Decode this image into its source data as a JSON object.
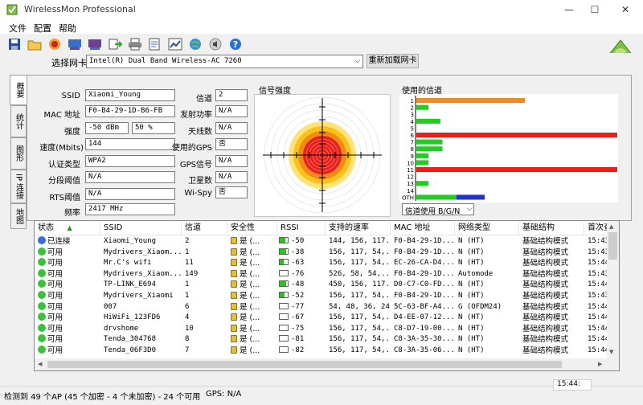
{
  "window": {
    "title": "WirelessMon Professional"
  },
  "menu": [
    {
      "label": "文件"
    },
    {
      "label": "配置"
    },
    {
      "label": "帮助"
    }
  ],
  "toolbar_icons": [
    "save-icon",
    "open-folder-icon",
    "record-icon",
    "network-card-icon",
    "network-card-alt-icon",
    "export-icon",
    "print-icon",
    "report-icon",
    "wifi-graph-icon",
    "globe-icon",
    "speaker-icon",
    "help-icon"
  ],
  "adapter": {
    "label": "选择网卡",
    "value": "Intel(R) Dual Band Wireless-AC 7260",
    "reload_label": "重新加载网卡"
  },
  "tabs": [
    {
      "label": "概要"
    },
    {
      "label": "统计"
    },
    {
      "label": "图形"
    },
    {
      "label": "IP 连接"
    },
    {
      "label": "地图"
    }
  ],
  "summary": {
    "ssid_label": "SSID",
    "ssid": "Xiaomi_Young",
    "mac_label": "MAC 地址",
    "mac": "F0-B4-29-1D-B6-FB",
    "strength_label": "强度",
    "strength_dbm": "-50 dBm",
    "strength_pct": "50 %",
    "speed_label": "速度(Mbits)",
    "speed": "144",
    "auth_label": "认证类型",
    "auth": "WPA2",
    "frag_label": "分段阈值",
    "frag": "N/A",
    "rts_label": "RTS阈值",
    "rts": "N/A",
    "freq_label": "频率",
    "freq": "2417 MHz",
    "channel_label": "信道",
    "channel": "2",
    "txpower_label": "发射功率",
    "txpower": "N/A",
    "antennas_label": "天线数",
    "antennas": "N/A",
    "gps_used_label": "使用的GPS",
    "gps_used": "否",
    "gps_signal_label": "GPS信号",
    "gps_signal": "N/A",
    "satellites_label": "卫星数",
    "satellites": "N/A",
    "wispy_label": "Wi-Spy",
    "wispy": "否"
  },
  "signal": {
    "title": "信号强度"
  },
  "channels": {
    "title": "使用的信道",
    "select_value": "信道使用 B/G/N",
    "rows": [
      {
        "ch": "1",
        "bars": [
          {
            "color": "#f08a24",
            "frac": 0.54
          }
        ]
      },
      {
        "ch": "2",
        "bars": [
          {
            "color": "#22cc22",
            "frac": 0.06
          }
        ]
      },
      {
        "ch": "3",
        "bars": []
      },
      {
        "ch": "4",
        "bars": [
          {
            "color": "#22cc22",
            "frac": 0.12
          }
        ]
      },
      {
        "ch": "5",
        "bars": []
      },
      {
        "ch": "6",
        "bars": [
          {
            "color": "#e8201a",
            "frac": 1.0
          }
        ]
      },
      {
        "ch": "7",
        "bars": [
          {
            "color": "#22cc22",
            "frac": 0.13
          }
        ]
      },
      {
        "ch": "8",
        "bars": [
          {
            "color": "#22cc22",
            "frac": 0.13
          }
        ]
      },
      {
        "ch": "9",
        "bars": [
          {
            "color": "#22cc22",
            "frac": 0.06
          }
        ]
      },
      {
        "ch": "10",
        "bars": [
          {
            "color": "#22cc22",
            "frac": 0.06
          }
        ]
      },
      {
        "ch": "11",
        "bars": [
          {
            "color": "#e8201a",
            "frac": 1.0
          }
        ]
      },
      {
        "ch": "12",
        "bars": []
      },
      {
        "ch": "13",
        "bars": [
          {
            "color": "#22cc22",
            "frac": 0.06
          }
        ]
      },
      {
        "ch": "14",
        "bars": []
      },
      {
        "ch": "OTH",
        "bars": [
          {
            "color": "#22cc22",
            "frac": 0.2
          },
          {
            "color": "#2233cc",
            "frac": 0.14
          }
        ]
      }
    ]
  },
  "list": {
    "columns": [
      "状态",
      "SSID",
      "信道",
      "安全性",
      "RSSI",
      "支持的速率",
      "MAC 地址",
      "网络类型",
      "基础结构",
      "首次查"
    ],
    "rows": [
      {
        "status": "已连接",
        "dot": "#3b6fd4",
        "ssid": "Xiaomi_Young",
        "channel": "2",
        "sec": "是 (...",
        "rssi_frac": 0.7,
        "rssi": "-50",
        "rates": "144, 156, 117...",
        "mac": "F0-B4-29-1D...",
        "nettype": "N (HT)",
        "infra": "基础结构模式",
        "first": "15:43:"
      },
      {
        "status": "可用",
        "dot": "#3cc13c",
        "ssid": "Mydrivers_Xiaom...",
        "channel": "1",
        "sec": "是 (...",
        "rssi_frac": 0.8,
        "rssi": "-38",
        "rates": "156, 117, 54,...",
        "mac": "F0-B4-29-1D...",
        "nettype": "N (HT)",
        "infra": "基础结构模式",
        "first": "15:43:"
      },
      {
        "status": "可用",
        "dot": "#3cc13c",
        "ssid": "Mr.C's wifi",
        "channel": "11",
        "sec": "是 (...",
        "rssi_frac": 0.45,
        "rssi": "-63",
        "rates": "156, 117, 54,...",
        "mac": "EC-26-CA-D4...",
        "nettype": "N (HT)",
        "infra": "基础结构模式",
        "first": "15:44:"
      },
      {
        "status": "可用",
        "dot": "#3cc13c",
        "ssid": "Mydrivers_Xiaom...",
        "channel": "149",
        "sec": "是 (...",
        "rssi_frac": 0.0,
        "rssi": "-76",
        "rates": "526, 58, 54,...",
        "mac": "F0-B4-29-1D...",
        "nettype": "Automode",
        "infra": "基础结构模式",
        "first": "15:43:"
      },
      {
        "status": "可用",
        "dot": "#3cc13c",
        "ssid": "TP-LINK_E694",
        "channel": "1",
        "sec": "是 (...",
        "rssi_frac": 0.75,
        "rssi": "-48",
        "rates": "450, 156, 117...",
        "mac": "D0-C7-C0-FD...",
        "nettype": "N (HT)",
        "infra": "基础结构模式",
        "first": "15:44:"
      },
      {
        "status": "可用",
        "dot": "#3cc13c",
        "ssid": "Mydrivers_Xiaomi",
        "channel": "1",
        "sec": "是 (...",
        "rssi_frac": 0.6,
        "rssi": "-52",
        "rates": "156, 117, 54,...",
        "mac": "F0-B4-29-1D...",
        "nettype": "N (HT)",
        "infra": "基础结构模式",
        "first": "15:43:"
      },
      {
        "status": "可用",
        "dot": "#3cc13c",
        "ssid": "007",
        "channel": "6",
        "sec": "是 (...",
        "rssi_frac": 0.0,
        "rssi": "-77",
        "rates": "54, 48, 36, 24...",
        "mac": "5C-63-BF-A4...",
        "nettype": "G (OFDM24)",
        "infra": "基础结构模式",
        "first": "15:44:"
      },
      {
        "status": "可用",
        "dot": "#3cc13c",
        "ssid": "HiWiFi_123FD6",
        "channel": "4",
        "sec": "是 (...",
        "rssi_frac": 0.0,
        "rssi": "-67",
        "rates": "156, 117, 54,...",
        "mac": "D4-EE-07-12...",
        "nettype": "N (HT)",
        "infra": "基础结构模式",
        "first": "15:44:"
      },
      {
        "status": "可用",
        "dot": "#3cc13c",
        "ssid": "drvshome",
        "channel": "10",
        "sec": "是 (...",
        "rssi_frac": 0.0,
        "rssi": "-75",
        "rates": "156, 117, 54,...",
        "mac": "C8-D7-19-00...",
        "nettype": "N (HT)",
        "infra": "基础结构模式",
        "first": "15:44:"
      },
      {
        "status": "可用",
        "dot": "#3cc13c",
        "ssid": "Tenda_304768",
        "channel": "8",
        "sec": "是 (...",
        "rssi_frac": 0.0,
        "rssi": "-81",
        "rates": "156, 117, 54,...",
        "mac": "C8-3A-35-30...",
        "nettype": "N (HT)",
        "infra": "基础结构模式",
        "first": "15:44:"
      },
      {
        "status": "可用",
        "dot": "#3cc13c",
        "ssid": "Tenda_06F3D0",
        "channel": "7",
        "sec": "是 (...",
        "rssi_frac": 0.0,
        "rssi": "-82",
        "rates": "156, 117, 54,...",
        "mac": "C8-3A-35-06...",
        "nettype": "N (HT)",
        "infra": "基础结构模式",
        "first": "15:44:"
      }
    ]
  },
  "status": {
    "main": "检测到 49 个AP (45 个加密 - 4 个未加密) - 24 个可用",
    "gps": "GPS: N/A",
    "time": "15:44:"
  }
}
